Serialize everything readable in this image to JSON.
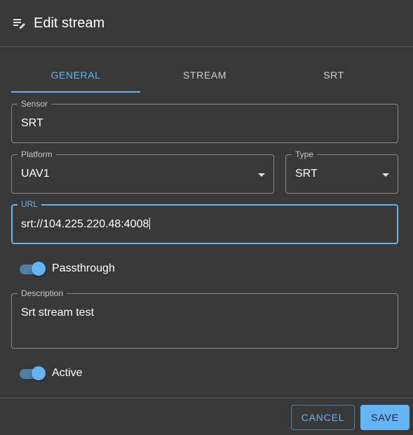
{
  "dialog": {
    "title": "Edit stream",
    "icon": "edit-note-icon"
  },
  "tabs": [
    {
      "label": "GENERAL",
      "active": true
    },
    {
      "label": "STREAM",
      "active": false
    },
    {
      "label": "SRT",
      "active": false
    }
  ],
  "form": {
    "sensor": {
      "label": "Sensor",
      "value": "SRT"
    },
    "platform": {
      "label": "Platform",
      "value": "UAV1"
    },
    "type": {
      "label": "Type",
      "value": "SRT"
    },
    "url": {
      "label": "URL",
      "value": "srt://104.225.220.48:4008"
    },
    "passthrough": {
      "label": "Passthrough",
      "checked": true
    },
    "description": {
      "label": "Description",
      "value": "Srt stream test"
    },
    "active": {
      "label": "Active",
      "checked": true
    }
  },
  "actions": {
    "cancel_label": "CANCEL",
    "save_label": "SAVE"
  },
  "colors": {
    "background": "#383838",
    "accent": "#64b5f6",
    "border": "#8a8a8a"
  }
}
